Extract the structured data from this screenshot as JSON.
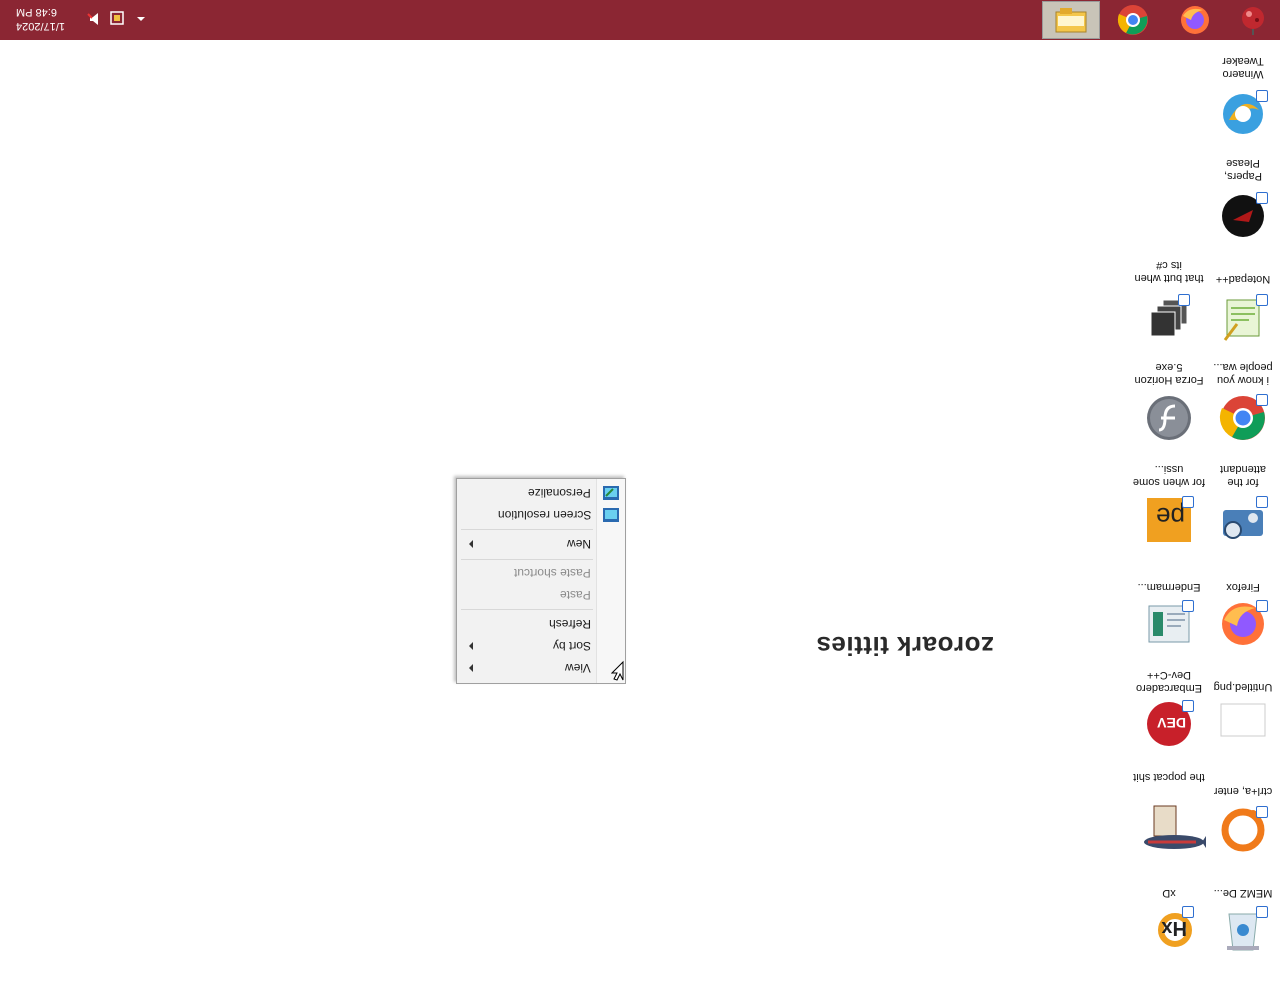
{
  "taskbar": {
    "clock": {
      "time": "6:48 PM",
      "date": "1/17/2024"
    },
    "pinned": [
      "explorer-icon",
      "chrome-icon",
      "firefox-icon",
      "app-icon"
    ],
    "tray_icons": [
      "speaker-icon",
      "network-icon",
      "overflow-chevron-icon"
    ]
  },
  "desktop": {
    "text": "zoroark titties",
    "icons": [
      {
        "label": "Winaero Tweaker",
        "icon": "winaero-tweaker-icon"
      },
      {
        "label": "Papers, Please",
        "icon": "papers-please-icon"
      },
      {
        "label": "Notepad++",
        "icon": "notepad-plus-plus-icon"
      },
      {
        "label": "that butt when its c#",
        "icon": "stacked-windows-icon"
      },
      {
        "label": "i know you people wa...",
        "icon": "chrome-icon"
      },
      {
        "label": "Forza Horizon 5.exe",
        "icon": "flash-icon"
      },
      {
        "label": "for the attendant",
        "icon": "projector-gear-icon"
      },
      {
        "label": "for when some ussi...",
        "icon": "paint-dot-net-icon"
      },
      {
        "label": "Firefox",
        "icon": "firefox-icon"
      },
      {
        "label": "Endermam...",
        "icon": "document-window-icon"
      },
      {
        "label": "Untitled.png",
        "icon": "blank-image-icon"
      },
      {
        "label": "Embarcadero Dev-C++",
        "icon": "dev-cpp-icon"
      },
      {
        "label": "ctrl+a, enter",
        "icon": "origin-icon"
      },
      {
        "label": "the popcat shit",
        "icon": "popcat-icon"
      },
      {
        "label": "MEMZ De...",
        "icon": "recycle-bin-icon"
      },
      {
        "label": "xD",
        "icon": "hxd-icon"
      }
    ]
  },
  "context_menu": {
    "items": [
      {
        "label": "Personalize",
        "icon": "personalize-icon",
        "disabled": false,
        "submenu": false
      },
      {
        "label": "Screen resolution",
        "icon": "screen-resolution-icon",
        "disabled": false,
        "submenu": false
      },
      {
        "label": "New",
        "disabled": false,
        "submenu": true
      },
      {
        "label": "Paste shortcut",
        "disabled": true,
        "submenu": false
      },
      {
        "label": "Paste",
        "disabled": true,
        "submenu": false
      },
      {
        "label": "Refresh",
        "disabled": false,
        "submenu": false
      },
      {
        "label": "Sort by",
        "disabled": false,
        "submenu": true
      },
      {
        "label": "View",
        "disabled": false,
        "submenu": true
      }
    ]
  },
  "colors": {
    "taskbar": "#8b2633",
    "desktop": "#ffffff"
  }
}
